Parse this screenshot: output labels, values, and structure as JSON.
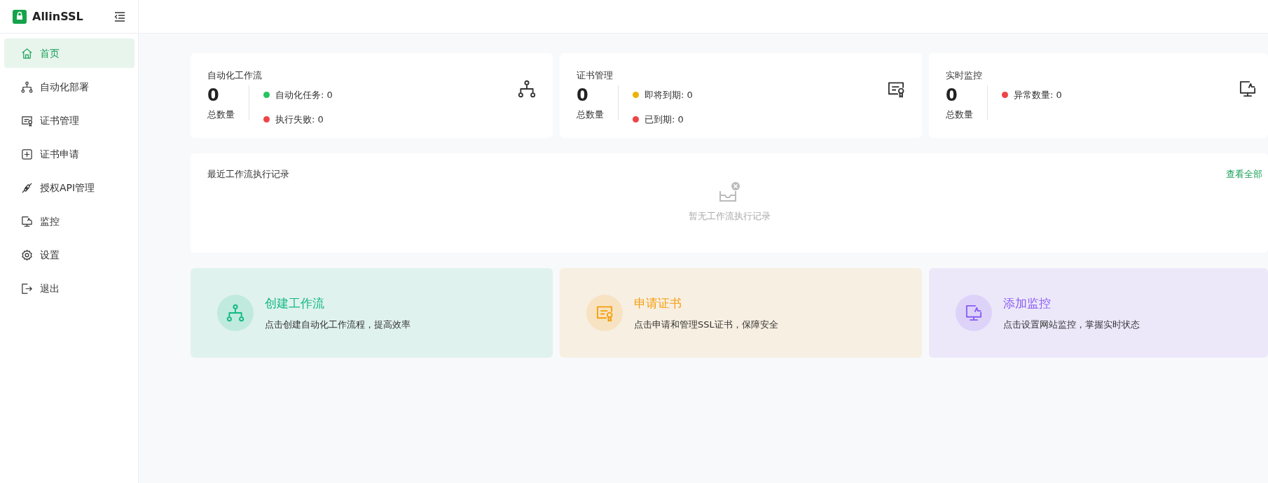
{
  "brand": {
    "name": "AllinSSL"
  },
  "sidebar": {
    "items": [
      {
        "label": "首页",
        "kind": "home",
        "selected": true
      },
      {
        "label": "自动化部署",
        "kind": "workflow",
        "selected": false
      },
      {
        "label": "证书管理",
        "kind": "certificate",
        "selected": false
      },
      {
        "label": "证书申请",
        "kind": "plus",
        "selected": false
      },
      {
        "label": "授权API管理",
        "kind": "plug",
        "selected": false
      },
      {
        "label": "监控",
        "kind": "monitor",
        "selected": false
      },
      {
        "label": "设置",
        "kind": "gear",
        "selected": false
      },
      {
        "label": "退出",
        "kind": "logout",
        "selected": false
      }
    ]
  },
  "stats": [
    {
      "title": "自动化工作流",
      "total": "0",
      "total_label": "总数量",
      "kind": "workflow",
      "items": [
        {
          "label": "自动化任务: 0",
          "color": "#22c55e"
        },
        {
          "label": "执行失败: 0",
          "color": "#ef4444"
        }
      ]
    },
    {
      "title": "证书管理",
      "total": "0",
      "total_label": "总数量",
      "kind": "certificate",
      "items": [
        {
          "label": "即将到期: 0",
          "color": "#eab308"
        },
        {
          "label": "已到期: 0",
          "color": "#ef4444"
        }
      ]
    },
    {
      "title": "实时监控",
      "total": "0",
      "total_label": "总数量",
      "kind": "monitor",
      "items": [
        {
          "label": "异常数量: 0",
          "color": "#ef4444"
        }
      ]
    }
  ],
  "recent": {
    "title": "最近工作流执行记录",
    "link": "查看全部",
    "empty_text": "暂无工作流执行记录"
  },
  "actions": [
    {
      "title": "创建工作流",
      "description": "点击创建自动化工作流程，提高效率",
      "kind": "workflow",
      "color": "#10b981"
    },
    {
      "title": "申请证书",
      "description": "点击申请和管理SSL证书，保障安全",
      "kind": "certificate",
      "color": "#f59e0b"
    },
    {
      "title": "添加监控",
      "description": "点击设置网站监控，掌握实时状态",
      "kind": "monitor",
      "color": "#8b5cf6"
    }
  ]
}
